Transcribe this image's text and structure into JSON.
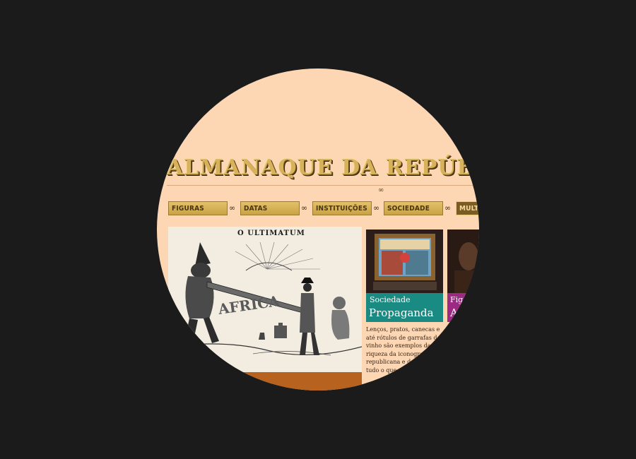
{
  "header": {
    "title": "ALMANAQUE DA REPÚBLICA"
  },
  "nav": {
    "items": [
      {
        "label": "FIGURAS"
      },
      {
        "label": "DATAS"
      },
      {
        "label": "INSTITUIÇÕES"
      },
      {
        "label": "SOCIEDADE"
      },
      {
        "label": "MULTI"
      }
    ]
  },
  "main_feature": {
    "caption": "O ULTIMATUM",
    "inscription": "AFRICA"
  },
  "card1": {
    "category": "Sociedade",
    "title": "Propaganda",
    "description": "Lenços, pratos, canecas e até rótulos de garrafas de vinho são exemplos da riqueza da iconografia republicana e de quase tudo o que se propaga"
  },
  "card2": {
    "category": "Fig",
    "title": "A"
  },
  "colors": {
    "background": "#fdd7b4",
    "nav_gold": "#d8b25a",
    "card1_accent": "#1a8b82",
    "card2_accent": "#9c2a83",
    "band": "#b8621f"
  }
}
